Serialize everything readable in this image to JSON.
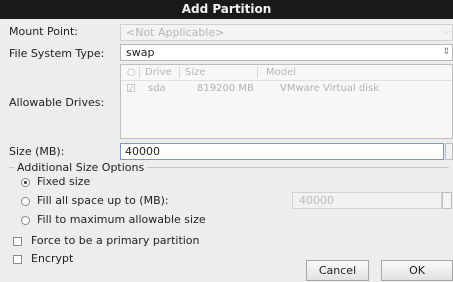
{
  "window": {
    "title": "Add Partition"
  },
  "mount_point": {
    "label": "Mount Point:",
    "value": "<Not Applicable>"
  },
  "fs_type": {
    "label": "File System Type:",
    "value": "swap"
  },
  "drives": {
    "label": "Allowable Drives:",
    "columns": [
      "Drive",
      "Size",
      "Model"
    ],
    "rows": [
      {
        "checked": true,
        "drive": "sda",
        "size": "819200 MB",
        "model": "VMware Virtual disk"
      }
    ]
  },
  "size": {
    "label": "Size (MB):",
    "value": "40000"
  },
  "additional": {
    "title": "Additional Size Options",
    "fixed": "Fixed size",
    "fill_up_to": "Fill all space up to (MB):",
    "fill_up_to_value": "40000",
    "fill_max": "Fill to maximum allowable size",
    "selected": "fixed"
  },
  "options": {
    "primary": "Force to be a primary partition",
    "encrypt": "Encrypt"
  },
  "buttons": {
    "cancel": "Cancel",
    "ok": "OK"
  }
}
